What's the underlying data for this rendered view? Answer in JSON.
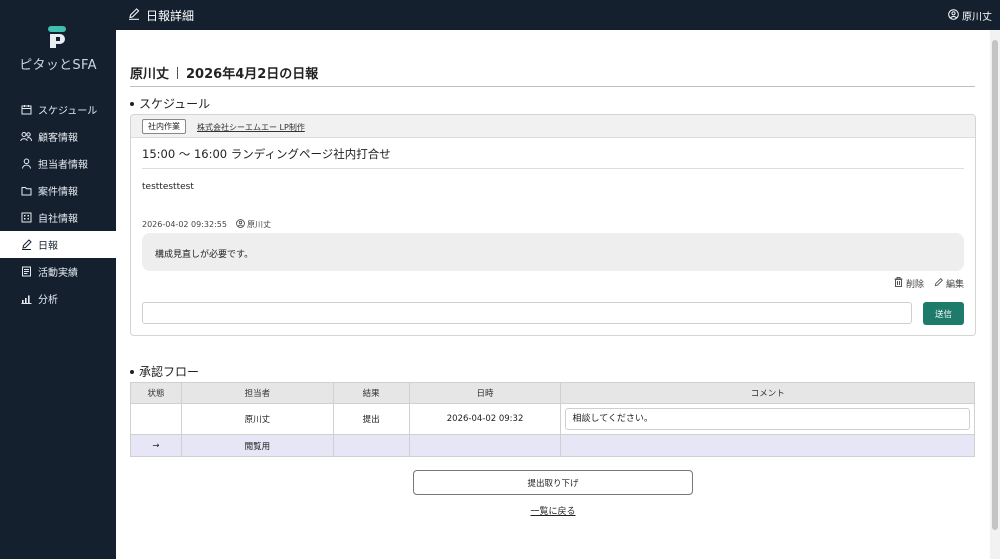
{
  "app": {
    "logo_text": "ピタッとSFA"
  },
  "header": {
    "title": "日報詳細",
    "user": "原川丈"
  },
  "sidebar": {
    "items": [
      {
        "label": "スケジュール",
        "icon": "calendar-icon",
        "active": false
      },
      {
        "label": "顧客情報",
        "icon": "people-icon",
        "active": false
      },
      {
        "label": "担当者情報",
        "icon": "person-icon",
        "active": false
      },
      {
        "label": "案件情報",
        "icon": "folder-icon",
        "active": false
      },
      {
        "label": "自社情報",
        "icon": "building-icon",
        "active": false
      },
      {
        "label": "日報",
        "icon": "pencil-icon",
        "active": true
      },
      {
        "label": "活動実績",
        "icon": "document-icon",
        "active": false
      },
      {
        "label": "分析",
        "icon": "bar-chart-icon",
        "active": false
      }
    ]
  },
  "page": {
    "author": "原川丈",
    "title": "2026年4月2日の日報"
  },
  "schedule": {
    "heading": "スケジュール",
    "tag": "社内作業",
    "company_link": "株式会社シーエムエー LP制作",
    "time_title": "15:00 〜 16:00  ランディングページ社内打合せ",
    "body": "testtesttest",
    "comment": {
      "timestamp": "2026-04-02 09:32:55",
      "user": "原川丈",
      "text": "構成見直しが必要です。",
      "delete_label": "削除",
      "edit_label": "編集"
    },
    "reply_placeholder": "",
    "send_label": "送信"
  },
  "approval": {
    "heading": "承認フロー",
    "columns": [
      "状態",
      "担当者",
      "結果",
      "日時",
      "コメント"
    ],
    "rows": [
      {
        "status": "",
        "person": "原川丈",
        "result": "提出",
        "datetime": "2026-04-02 09:32",
        "comment": "相談してください。"
      },
      {
        "status": "→",
        "person": "閲覧用",
        "result": "",
        "datetime": "",
        "comment": ""
      }
    ]
  },
  "buttons": {
    "withdraw": "提出取り下げ",
    "back": "一覧に戻る"
  },
  "colors": {
    "sidebar_bg": "#15202f",
    "accent_green": "#1e7a6b",
    "pending_row": "#e7e6f6"
  }
}
